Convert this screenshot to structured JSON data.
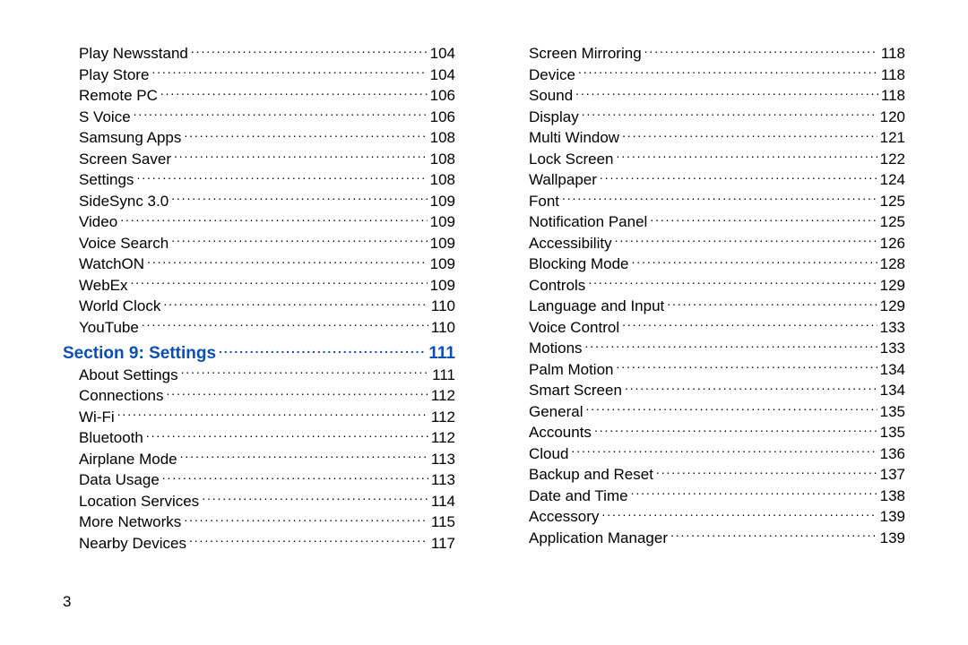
{
  "footer_page_number": "3",
  "left_column": [
    {
      "label": "Play Newsstand",
      "page": "104",
      "type": "entry",
      "indent": true
    },
    {
      "label": "Play Store",
      "page": "104",
      "type": "entry",
      "indent": true
    },
    {
      "label": "Remote PC",
      "page": "106",
      "type": "entry",
      "indent": true
    },
    {
      "label": "S Voice",
      "page": "106",
      "type": "entry",
      "indent": true
    },
    {
      "label": "Samsung Apps",
      "page": "108",
      "type": "entry",
      "indent": true
    },
    {
      "label": "Screen Saver",
      "page": "108",
      "type": "entry",
      "indent": true
    },
    {
      "label": "Settings",
      "page": "108",
      "type": "entry",
      "indent": true
    },
    {
      "label": "SideSync 3.0",
      "page": "109",
      "type": "entry",
      "indent": true
    },
    {
      "label": "Video",
      "page": "109",
      "type": "entry",
      "indent": true
    },
    {
      "label": "Voice Search",
      "page": "109",
      "type": "entry",
      "indent": true
    },
    {
      "label": "WatchON",
      "page": "109",
      "type": "entry",
      "indent": true
    },
    {
      "label": "WebEx",
      "page": "109",
      "type": "entry",
      "indent": true
    },
    {
      "label": "World Clock",
      "page": "110",
      "type": "entry",
      "indent": true
    },
    {
      "label": "YouTube",
      "page": "110",
      "type": "entry",
      "indent": true
    },
    {
      "label": "Section 9:  Settings",
      "page": "111",
      "type": "section",
      "indent": false
    },
    {
      "label": "About Settings",
      "page": "111",
      "type": "entry",
      "indent": true
    },
    {
      "label": "Connections",
      "page": "112",
      "type": "entry",
      "indent": true
    },
    {
      "label": "Wi-Fi",
      "page": "112",
      "type": "entry",
      "indent": true
    },
    {
      "label": "Bluetooth",
      "page": "112",
      "type": "entry",
      "indent": true
    },
    {
      "label": "Airplane Mode",
      "page": "113",
      "type": "entry",
      "indent": true
    },
    {
      "label": "Data Usage",
      "page": "113",
      "type": "entry",
      "indent": true
    },
    {
      "label": "Location Services",
      "page": "114",
      "type": "entry",
      "indent": true
    },
    {
      "label": "More Networks",
      "page": "115",
      "type": "entry",
      "indent": true
    },
    {
      "label": "Nearby Devices",
      "page": "117",
      "type": "entry",
      "indent": true
    }
  ],
  "right_column": [
    {
      "label": "Screen Mirroring",
      "page": "118",
      "type": "entry",
      "indent": true
    },
    {
      "label": "Device",
      "page": "118",
      "type": "entry",
      "indent": true
    },
    {
      "label": "Sound",
      "page": "118",
      "type": "entry",
      "indent": true
    },
    {
      "label": "Display",
      "page": "120",
      "type": "entry",
      "indent": true
    },
    {
      "label": "Multi Window",
      "page": "121",
      "type": "entry",
      "indent": true
    },
    {
      "label": "Lock Screen",
      "page": "122",
      "type": "entry",
      "indent": true
    },
    {
      "label": "Wallpaper",
      "page": "124",
      "type": "entry",
      "indent": true
    },
    {
      "label": "Font",
      "page": "125",
      "type": "entry",
      "indent": true
    },
    {
      "label": "Notification Panel",
      "page": "125",
      "type": "entry",
      "indent": true
    },
    {
      "label": "Accessibility",
      "page": "126",
      "type": "entry",
      "indent": true
    },
    {
      "label": "Blocking Mode",
      "page": "128",
      "type": "entry",
      "indent": true
    },
    {
      "label": "Controls",
      "page": "129",
      "type": "entry",
      "indent": true
    },
    {
      "label": "Language and Input",
      "page": "129",
      "type": "entry",
      "indent": true
    },
    {
      "label": "Voice Control",
      "page": "133",
      "type": "entry",
      "indent": true
    },
    {
      "label": "Motions",
      "page": "133",
      "type": "entry",
      "indent": true
    },
    {
      "label": "Palm Motion",
      "page": "134",
      "type": "entry",
      "indent": true
    },
    {
      "label": "Smart Screen",
      "page": "134",
      "type": "entry",
      "indent": true
    },
    {
      "label": "General",
      "page": "135",
      "type": "entry",
      "indent": true
    },
    {
      "label": "Accounts",
      "page": "135",
      "type": "entry",
      "indent": true
    },
    {
      "label": "Cloud",
      "page": "136",
      "type": "entry",
      "indent": true
    },
    {
      "label": "Backup and Reset",
      "page": "137",
      "type": "entry",
      "indent": true
    },
    {
      "label": "Date and Time",
      "page": "138",
      "type": "entry",
      "indent": true
    },
    {
      "label": "Accessory",
      "page": "139",
      "type": "entry",
      "indent": true
    },
    {
      "label": "Application Manager",
      "page": "139",
      "type": "entry",
      "indent": true
    }
  ]
}
